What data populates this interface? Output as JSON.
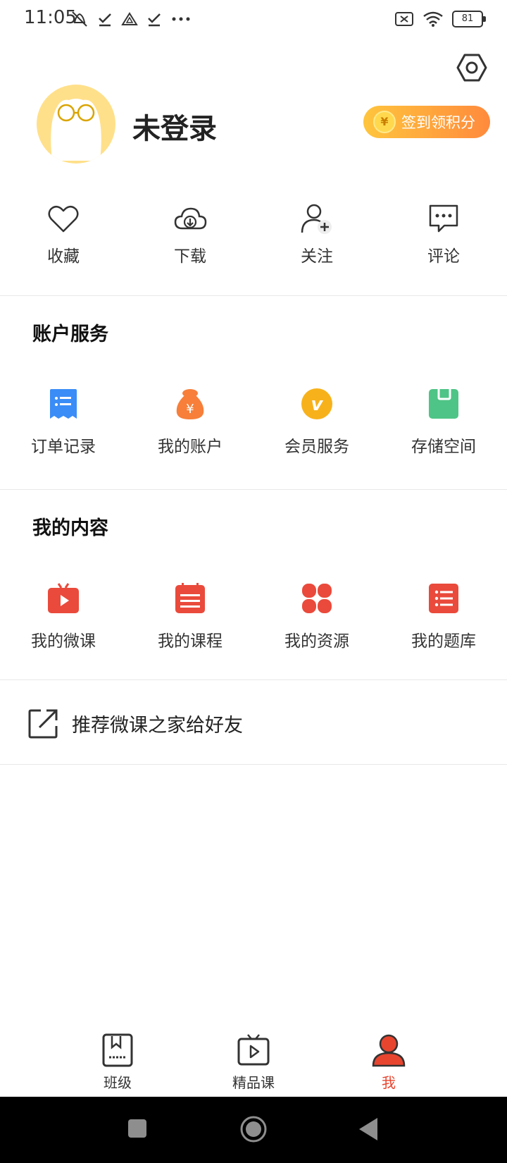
{
  "status_bar": {
    "time": "11:05",
    "left_icons": [
      "mute-icon",
      "check-icon",
      "drive-icon",
      "check-icon",
      "more-dots-icon"
    ],
    "right_icons": [
      "sim-off-icon",
      "wifi-icon",
      "battery-icon"
    ],
    "battery": "81"
  },
  "header": {
    "user_name": "未登录",
    "signin_label": "签到领积分",
    "coin_symbol": "¥"
  },
  "quick_actions": [
    {
      "label": "收藏",
      "icon": "heart-icon"
    },
    {
      "label": "下载",
      "icon": "cloud-download-icon"
    },
    {
      "label": "关注",
      "icon": "add-user-icon"
    },
    {
      "label": "评论",
      "icon": "comment-icon"
    }
  ],
  "account_services": {
    "title": "账户服务",
    "items": [
      {
        "label": "订单记录",
        "icon": "order-record-icon",
        "color": "#3a8df7"
      },
      {
        "label": "我的账户",
        "icon": "money-bag-icon",
        "color": "#f77f3a"
      },
      {
        "label": "会员服务",
        "icon": "vip-icon",
        "color": "#f7b21b"
      },
      {
        "label": "存储空间",
        "icon": "storage-icon",
        "color": "#4ec486"
      }
    ]
  },
  "my_content": {
    "title": "我的内容",
    "items": [
      {
        "label": "我的微课",
        "icon": "video-tv-icon",
        "color": "#ea4a3b"
      },
      {
        "label": "我的课程",
        "icon": "calendar-course-icon",
        "color": "#ea4a3b"
      },
      {
        "label": "我的资源",
        "icon": "resource-grid-icon",
        "color": "#ea4a3b"
      },
      {
        "label": "我的题库",
        "icon": "question-list-icon",
        "color": "#ea4a3b"
      }
    ]
  },
  "share": {
    "label": "推荐微课之家给好友",
    "icon": "share-external-icon"
  },
  "bottom_nav": [
    {
      "label": "班级",
      "icon": "class-book-icon",
      "active": false
    },
    {
      "label": "精品课",
      "icon": "tv-play-icon",
      "active": false
    },
    {
      "label": "我",
      "icon": "user-profile-icon",
      "active": true
    }
  ],
  "colors": {
    "accent": "#e8452f",
    "signin_gradient_start": "#ffc53d",
    "signin_gradient_end": "#ff8a3d"
  }
}
